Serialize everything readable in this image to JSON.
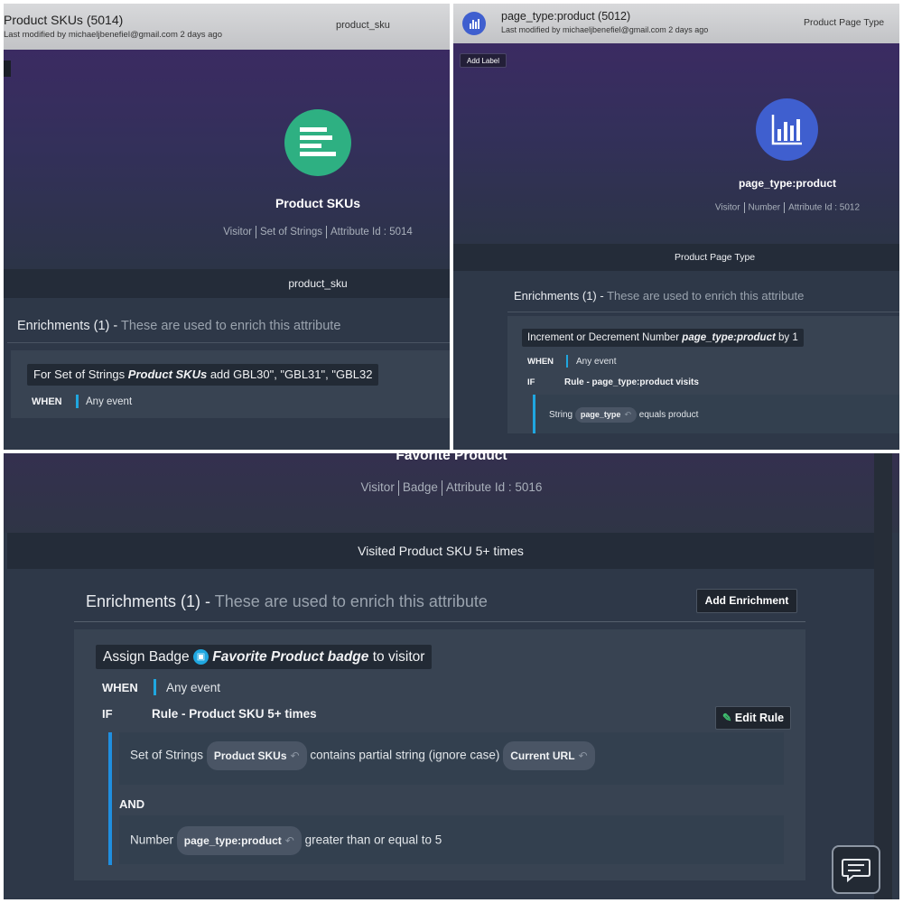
{
  "panel1": {
    "title": "Product SKUs (5014)",
    "modified": "Last modified by michaeljbenefiel@gmail.com 2 days ago",
    "label_right": "product_sku",
    "name": "Product SKUs",
    "meta": [
      "Visitor",
      "Set of Strings",
      "Attribute Id : 5014"
    ],
    "band_label": "product_sku",
    "enrichments_count": "Enrichments (1) -",
    "enrichments_desc": "These are used to enrich this attribute",
    "action_prefix": "For Set of Strings",
    "action_attr": "Product SKUs",
    "action_suffix": "add GBL30\", \"GBL31\", \"GBL32",
    "when_label": "WHEN",
    "when_value": "Any event",
    "icon": "list-icon",
    "icon_color": "#2eb082"
  },
  "panel2": {
    "title": "page_type:product (5012)",
    "modified": "Last modified by michaeljbenefiel@gmail.com 2 days ago",
    "label_right": "Product Page Type",
    "add_label": "Add Label",
    "name": "page_type:product",
    "meta": [
      "Visitor",
      "Number",
      "Attribute Id : 5012"
    ],
    "band_label": "Product Page Type",
    "enrichments_count": "Enrichments (1) -",
    "enrichments_desc": "These are used to enrich this attribute",
    "action_prefix": "Increment or Decrement Number",
    "action_attr": "page_type:product",
    "action_suffix": "by 1",
    "when_label": "WHEN",
    "when_value": "Any event",
    "if_label": "IF",
    "rule_name": "Rule - page_type:product visits",
    "cond_type": "String",
    "cond_chip": "page_type",
    "cond_op": "equals product",
    "icon": "bar-chart-icon",
    "icon_color": "#3f5fcf"
  },
  "panel3": {
    "name": "Favorite Product",
    "meta": [
      "Visitor",
      "Badge",
      "Attribute Id : 5016"
    ],
    "band_label": "Visited Product SKU 5+ times",
    "enrichments_count": "Enrichments (1) -",
    "enrichments_desc": "These are used to enrich this attribute",
    "add_enrichment": "Add Enrichment",
    "action_prefix": "Assign Badge",
    "action_attr": "Favorite Product badge",
    "action_suffix": "to visitor",
    "when_label": "WHEN",
    "when_value": "Any event",
    "if_label": "IF",
    "rule_name": "Rule - Product SKU 5+ times",
    "edit_rule": "Edit Rule",
    "cond1_type": "Set of Strings",
    "cond1_chip": "Product SKUs",
    "cond1_op": "contains partial string (ignore case)",
    "cond1_chip2": "Current URL",
    "and_label": "AND",
    "cond2_type": "Number",
    "cond2_chip": "page_type:product",
    "cond2_op": "greater than or equal to 5",
    "chat_icon": "chat-icon"
  }
}
